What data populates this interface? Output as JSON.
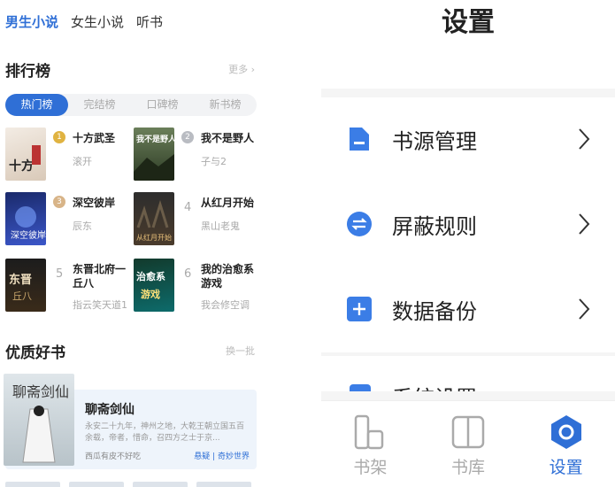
{
  "left": {
    "top_tabs": [
      "男生小说",
      "女生小说",
      "听书"
    ],
    "ranking": {
      "title": "排行榜",
      "more": "更多",
      "tabs": [
        "热门榜",
        "完结榜",
        "口碑榜",
        "新书榜"
      ],
      "items": [
        {
          "rank": "1",
          "title": "十方武圣",
          "author": "滚开"
        },
        {
          "rank": "2",
          "title": "我不是野人",
          "author": "子与2"
        },
        {
          "rank": "3",
          "title": "深空彼岸",
          "author": "辰东"
        },
        {
          "rank": "4",
          "title": "从红月开始",
          "author": "黑山老鬼"
        },
        {
          "rank": "5",
          "title": "东晋北府一丘八",
          "author": "指云笑天道1"
        },
        {
          "rank": "6",
          "title": "我的治愈系游戏",
          "author": "我会修空调"
        }
      ]
    },
    "quality": {
      "title": "优质好书",
      "action": "换一批",
      "book": {
        "title": "聊斋剑仙",
        "desc": "永安二十九年，神州之地，大乾王朝立国五百余载，帝者，惜命，召四方之士于京...",
        "author": "西瓜有皮不好吃",
        "tags": "悬疑 | 奇妙世界"
      }
    }
  },
  "right": {
    "title": "设置",
    "items": [
      {
        "label": "书源管理",
        "icon": "document-icon"
      },
      {
        "label": "屏蔽规则",
        "icon": "swap-icon"
      },
      {
        "label": "数据备份",
        "icon": "plus-icon"
      }
    ],
    "partial_item": "系统设置",
    "nav": [
      {
        "label": "书架",
        "icon": "bookshelf-icon",
        "active": false
      },
      {
        "label": "书库",
        "icon": "library-icon",
        "active": false
      },
      {
        "label": "设置",
        "icon": "settings-icon",
        "active": true
      }
    ],
    "accent": "#2f6fd6"
  }
}
